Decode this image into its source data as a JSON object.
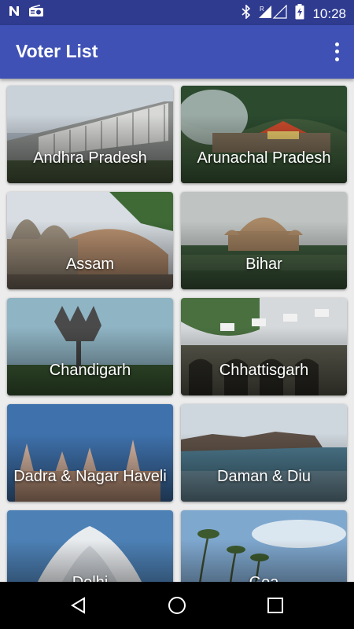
{
  "status": {
    "time": "10:28"
  },
  "app": {
    "title": "Voter List"
  },
  "states": [
    {
      "label": "Andhra Pradesh"
    },
    {
      "label": "Arunachal Pradesh"
    },
    {
      "label": "Assam"
    },
    {
      "label": "Bihar"
    },
    {
      "label": "Chandigarh"
    },
    {
      "label": "Chhattisgarh"
    },
    {
      "label": "Dadra & Nagar Haveli"
    },
    {
      "label": "Daman & Diu"
    },
    {
      "label": "Delhi"
    },
    {
      "label": "Goa"
    }
  ],
  "icons": {
    "status_left": [
      "n-notification-icon",
      "radio-icon"
    ],
    "status_right": [
      "bluetooth-icon",
      "signal-icon",
      "battery-charging-icon"
    ],
    "nav": [
      "back-icon",
      "home-icon",
      "recents-icon"
    ]
  }
}
